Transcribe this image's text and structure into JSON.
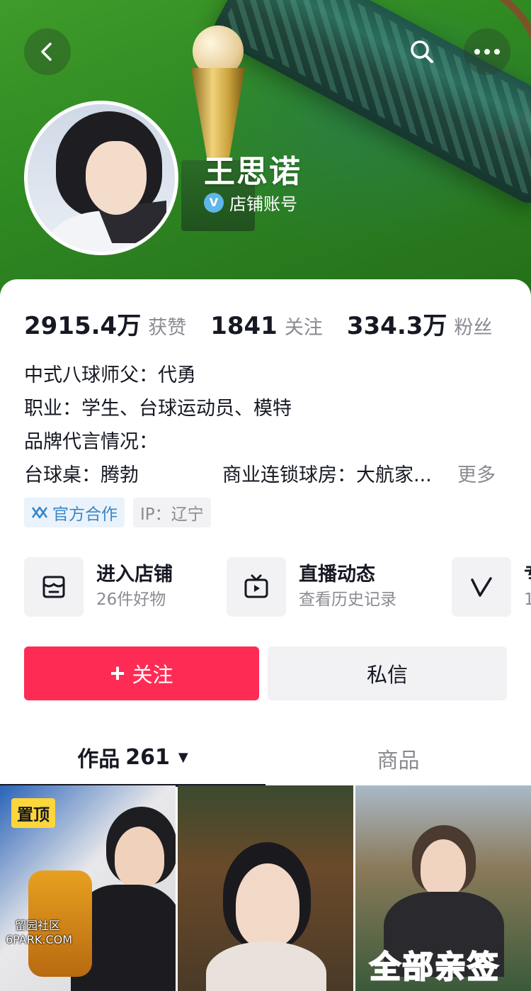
{
  "header": {
    "name": "王思诺",
    "verify_label": "店铺账号",
    "verify_badge": "V",
    "icons": {
      "back": "back-arrow-icon",
      "search": "search-icon",
      "more": "more-dots-icon"
    }
  },
  "stats": [
    {
      "num": "2915.4万",
      "label": "获赞"
    },
    {
      "num": "1841",
      "label": "关注"
    },
    {
      "num": "334.3万",
      "label": "粉丝"
    }
  ],
  "bio": {
    "line1": "中式八球师父：代勇",
    "line2": "职业：学生、台球运动员、模特",
    "line3": "品牌代言情况：",
    "line4_a": "台球桌：腾勃",
    "line4_b": "商业连锁球房：大航家...",
    "more": "更多"
  },
  "tags": {
    "official": "官方合作",
    "ip": "IP：辽宁"
  },
  "shortcuts": [
    {
      "title": "进入店铺",
      "sub": "26件好物",
      "icon": "shop-icon"
    },
    {
      "title": "直播动态",
      "sub": "查看历史记录",
      "icon": "tv-icon"
    },
    {
      "title": "专",
      "sub": "1",
      "icon": "v-icon"
    }
  ],
  "actions": {
    "follow": "关注",
    "follow_icon": "+",
    "message": "私信"
  },
  "tabs": {
    "works": "作品",
    "works_count": "261",
    "goods": "商品"
  },
  "grid": {
    "pin_label": "置顶",
    "thumb3_text": "全部亲签"
  },
  "watermark": {
    "line1": "留园社区",
    "line2": "6PARK.COM"
  },
  "colors": {
    "accent": "#fe2c55",
    "banner_green": "#2f8a22",
    "official_blue": "#3a86c8"
  }
}
